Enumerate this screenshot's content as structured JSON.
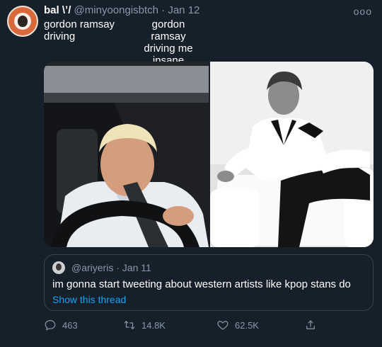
{
  "tweet": {
    "display_name": "bal",
    "name_suffix": "\\ʼ/",
    "handle": "@minyoongisbtch",
    "separator": "·",
    "date": "Jan 12",
    "more": "ooo",
    "caption_left": [
      "gordon ramsay",
      "driving"
    ],
    "caption_right": [
      "gordon ramsay",
      "driving me",
      "insane"
    ]
  },
  "media": {
    "images": [
      {
        "alt": "gordon-ramsay-driving-photo"
      },
      {
        "alt": "gordon-ramsay-sitting-photo"
      }
    ]
  },
  "quote": {
    "handle": "@ariyeris",
    "separator": "·",
    "date": "Jan 11",
    "text": "im gonna start tweeting about western artists like kpop stans do",
    "link_label": "Show this thread",
    "link_color": "#1da1f2"
  },
  "actions": {
    "reply_count": "463",
    "retweet_count": "14.8K",
    "like_count": "62.5K"
  },
  "colors": {
    "background": "#15202b",
    "secondary_text": "#8899a6",
    "border": "#38444d"
  }
}
